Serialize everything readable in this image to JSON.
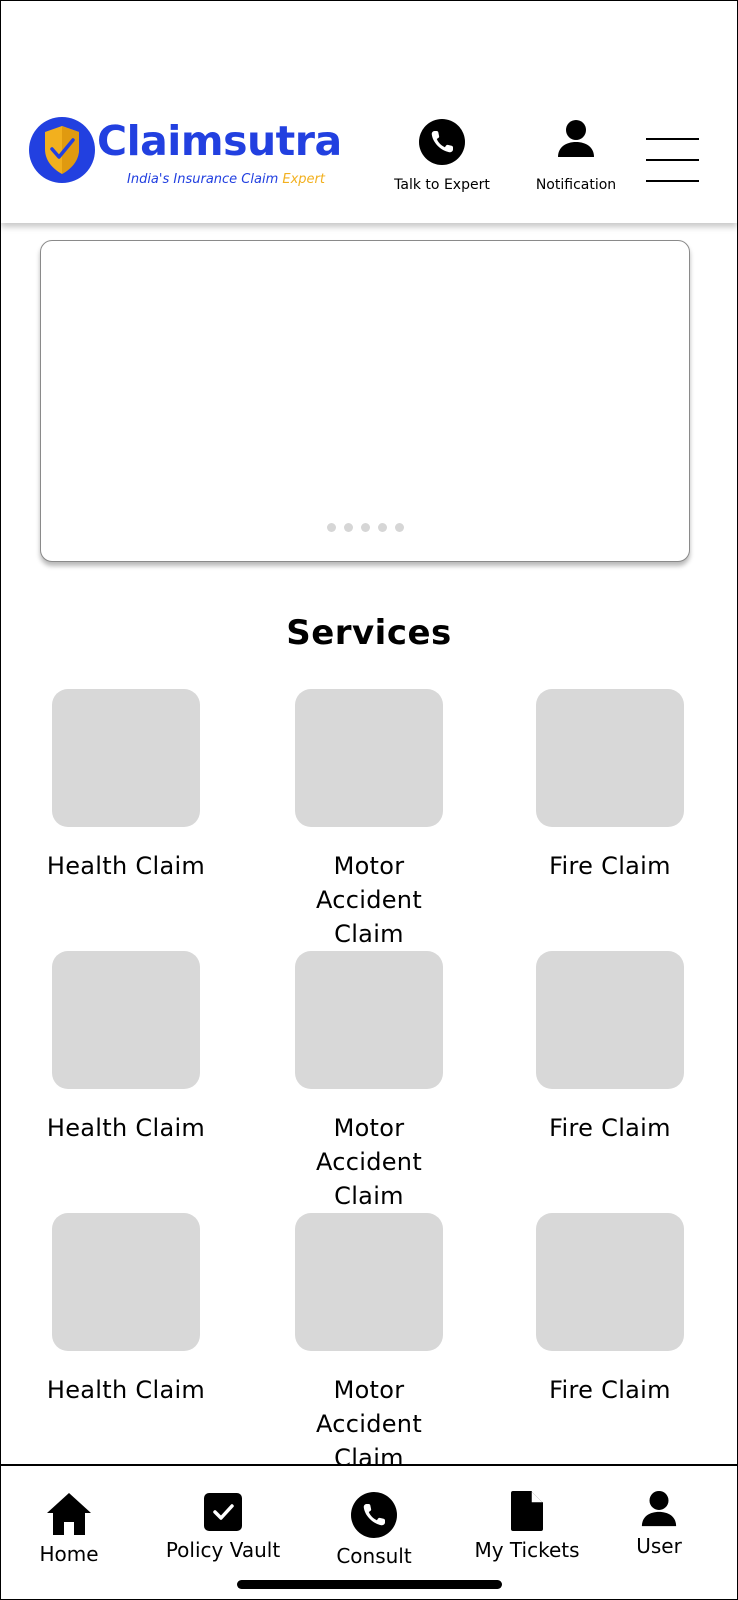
{
  "header": {
    "logo": {
      "name": "Claimsutra",
      "tagline_main": "India's Insurance Claim ",
      "tagline_accent": "Expert",
      "colors": {
        "brand_blue": "#2240e0",
        "brand_gold": "#f2b01e"
      }
    },
    "talk_to_expert": {
      "label": "Talk to Expert",
      "icon": "phone-icon"
    },
    "notification": {
      "label": "Notification",
      "icon": "user-icon"
    },
    "menu": {
      "icon": "hamburger-menu-icon"
    }
  },
  "banner": {
    "slide_count": 5,
    "dot_color": "#d6d6d6"
  },
  "services": {
    "title": "Services",
    "tile_color": "#d8d8d8",
    "items": [
      {
        "label": "Health Claim"
      },
      {
        "label": "Motor Accident Claim"
      },
      {
        "label": "Fire Claim"
      },
      {
        "label": "Health Claim"
      },
      {
        "label": "Motor Accident Claim"
      },
      {
        "label": "Fire Claim"
      },
      {
        "label": "Health Claim"
      },
      {
        "label": "Motor Accident Claim"
      },
      {
        "label": "Fire Claim"
      }
    ]
  },
  "bottom_nav": {
    "items": [
      {
        "label": "Home",
        "icon": "home-icon"
      },
      {
        "label": "Policy Vault",
        "icon": "checkbox-icon"
      },
      {
        "label": "Consult",
        "icon": "phone-icon"
      },
      {
        "label": "My Tickets",
        "icon": "document-icon"
      },
      {
        "label": "User",
        "icon": "user-icon"
      }
    ]
  }
}
